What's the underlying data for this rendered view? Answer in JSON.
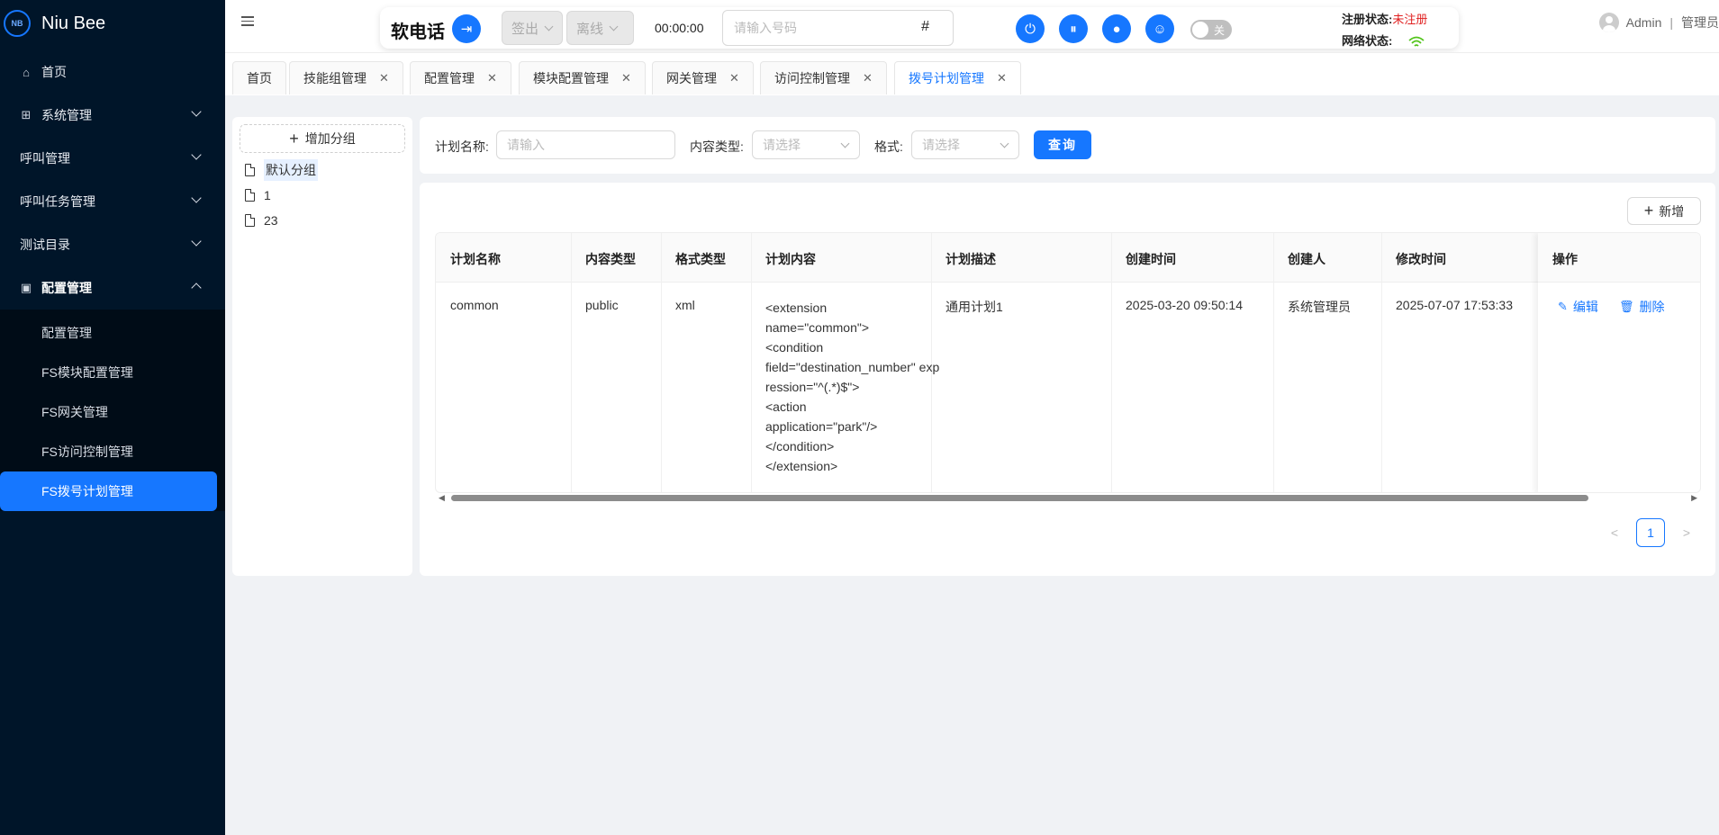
{
  "app": {
    "logo_mark": "NB",
    "name": "Niu Bee"
  },
  "sidebar": {
    "items": [
      {
        "label": "首页",
        "icon": "home-icon"
      },
      {
        "label": "系统管理",
        "icon": "grid-icon"
      },
      {
        "label": "呼叫管理"
      },
      {
        "label": "呼叫任务管理"
      },
      {
        "label": "测试目录"
      },
      {
        "label": "配置管理",
        "icon": "config-icon"
      }
    ],
    "subitems": [
      {
        "label": "配置管理"
      },
      {
        "label": "FS模块配置管理"
      },
      {
        "label": "FS网关管理"
      },
      {
        "label": "FS访问控制管理"
      },
      {
        "label": "FS拨号计划管理"
      }
    ]
  },
  "phonebar": {
    "title": "软电话",
    "signout": "签出",
    "status_select": "离线",
    "timer": "00:00:00",
    "dial_placeholder": "请输入号码",
    "dial_hash": "#",
    "toggle_label": "关",
    "reg_label": "注册状态:",
    "reg_value": "未注册",
    "net_label": "网络状态:"
  },
  "user": {
    "name": "Admin",
    "role": "管理员"
  },
  "tabs": [
    {
      "label": "首页"
    },
    {
      "label": "技能组管理"
    },
    {
      "label": "配置管理"
    },
    {
      "label": "模块配置管理"
    },
    {
      "label": "网关管理"
    },
    {
      "label": "访问控制管理"
    },
    {
      "label": "拨号计划管理"
    }
  ],
  "groups": {
    "add_label": "增加分组",
    "items": [
      {
        "label": "默认分组"
      },
      {
        "label": "1"
      },
      {
        "label": "23"
      }
    ]
  },
  "search": {
    "name_label": "计划名称:",
    "name_placeholder": "请输入",
    "type_label": "内容类型:",
    "type_placeholder": "请选择",
    "format_label": "格式:",
    "format_placeholder": "请选择",
    "query_label": "查询"
  },
  "table": {
    "add_label": "新增",
    "columns": [
      "计划名称",
      "内容类型",
      "格式类型",
      "计划内容",
      "计划描述",
      "创建时间",
      "创建人",
      "修改时间",
      "操作"
    ],
    "rows": [
      {
        "name": "common",
        "content_type": "public",
        "format": "xml",
        "content": "<extension\nname=\"common\">\n<condition\nfield=\"destination_number\" expression=\"^(.*)$\">\n<action\napplication=\"park\"/>\n</condition>\n</extension>",
        "desc": "通用计划1",
        "created": "2025-03-20 09:50:14",
        "creator": "系统管理员",
        "modified": "2025-07-07 17:53:33",
        "edit_label": "编辑",
        "delete_label": "删除"
      }
    ]
  },
  "pagination": {
    "current": "1",
    "prev": "<",
    "next": ">"
  }
}
